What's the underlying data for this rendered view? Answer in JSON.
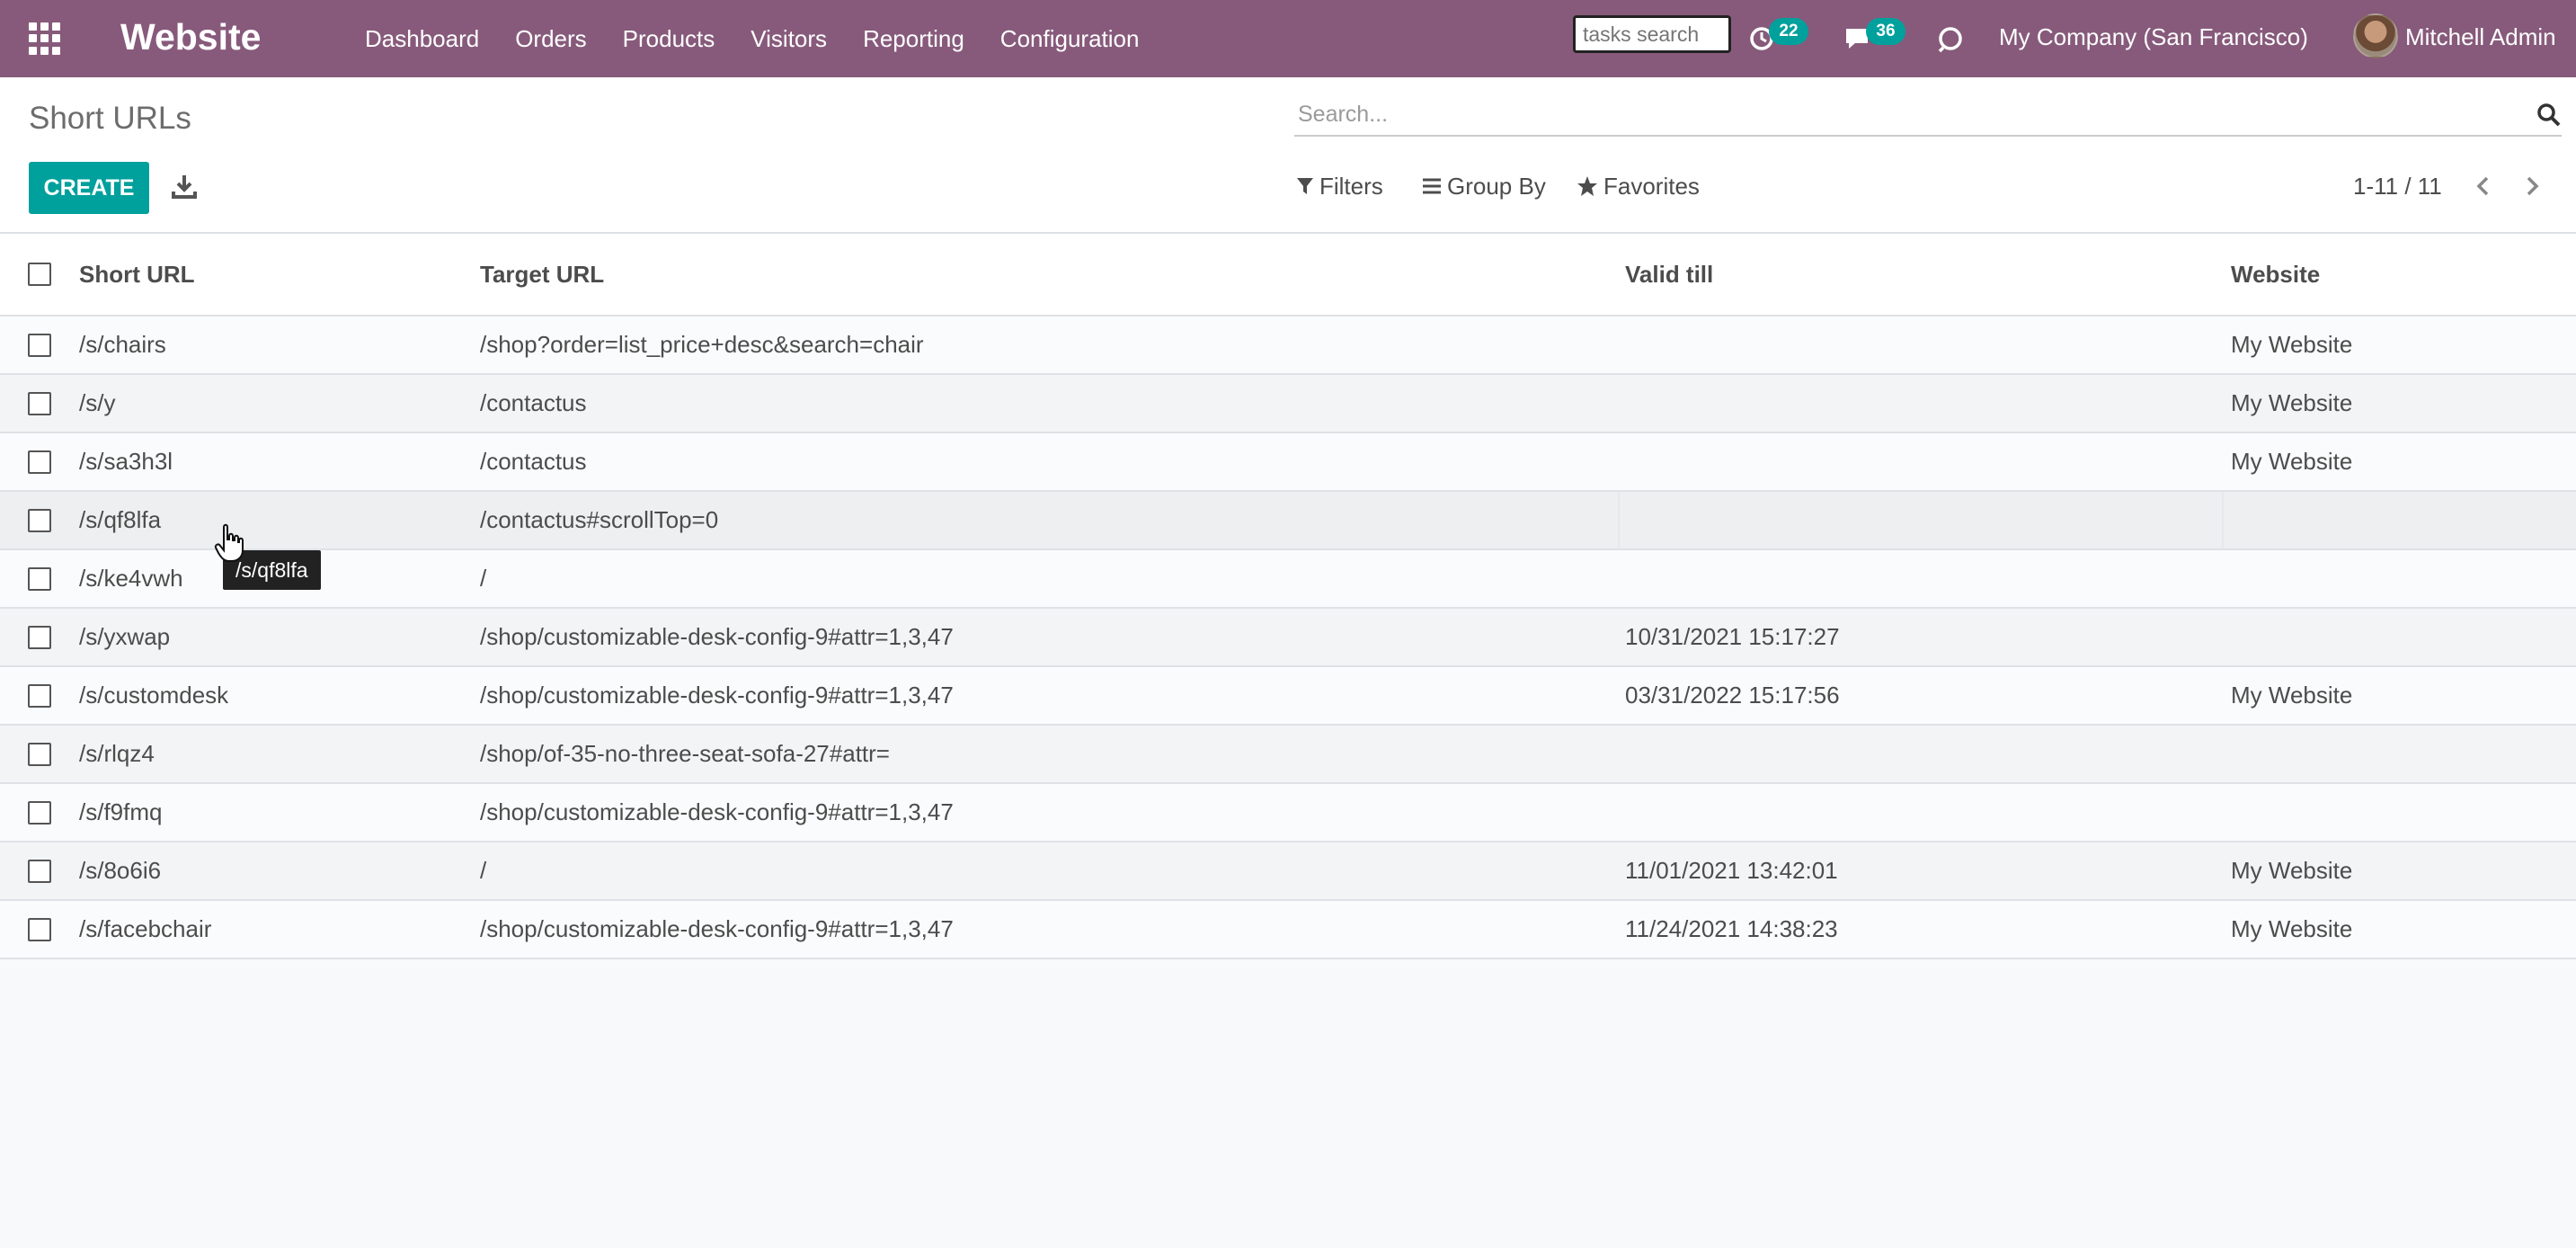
{
  "navbar": {
    "brand": "Website",
    "menu": [
      "Dashboard",
      "Orders",
      "Products",
      "Visitors",
      "Reporting",
      "Configuration"
    ],
    "tasks_search_placeholder": "tasks search",
    "activity_count": "22",
    "messages_count": "36",
    "company": "My Company (San Francisco)",
    "user": "Mitchell Admin",
    "colors": {
      "navbar_bg": "#875a7b",
      "accent": "#00a09d"
    }
  },
  "control_panel": {
    "title": "Short URLs",
    "create_label": "CREATE",
    "search_placeholder": "Search...",
    "filters_label": "Filters",
    "group_by_label": "Group By",
    "favorites_label": "Favorites",
    "pager": "1-11 / 11"
  },
  "table": {
    "headers": [
      "Short URL",
      "Target URL",
      "Valid till",
      "Website"
    ],
    "rows": [
      {
        "short": "/s/chairs",
        "target": "/shop?order=list_price+desc&search=chair",
        "valid": "",
        "website": "My Website"
      },
      {
        "short": "/s/y",
        "target": "/contactus",
        "valid": "",
        "website": "My Website"
      },
      {
        "short": "/s/sa3h3l",
        "target": "/contactus",
        "valid": "",
        "website": "My Website"
      },
      {
        "short": "/s/qf8lfa",
        "target": "/contactus#scrollTop=0",
        "valid": "",
        "website": ""
      },
      {
        "short": "/s/ke4vwh",
        "target": "/",
        "valid": "",
        "website": ""
      },
      {
        "short": "/s/yxwap",
        "target": "/shop/customizable-desk-config-9#attr=1,3,47",
        "valid": "10/31/2021 15:17:27",
        "website": ""
      },
      {
        "short": "/s/customdesk",
        "target": "/shop/customizable-desk-config-9#attr=1,3,47",
        "valid": "03/31/2022 15:17:56",
        "website": "My Website"
      },
      {
        "short": "/s/rlqz4",
        "target": "/shop/of-35-no-three-seat-sofa-27#attr=",
        "valid": "",
        "website": ""
      },
      {
        "short": "/s/f9fmq",
        "target": "/shop/customizable-desk-config-9#attr=1,3,47",
        "valid": "",
        "website": ""
      },
      {
        "short": "/s/8o6i6",
        "target": "/",
        "valid": "11/01/2021 13:42:01",
        "website": "My Website"
      },
      {
        "short": "/s/facebchair",
        "target": "/shop/customizable-desk-config-9#attr=1,3,47",
        "valid": "11/24/2021 14:38:23",
        "website": "My Website"
      }
    ]
  },
  "tooltip": "/s/qf8lfa"
}
